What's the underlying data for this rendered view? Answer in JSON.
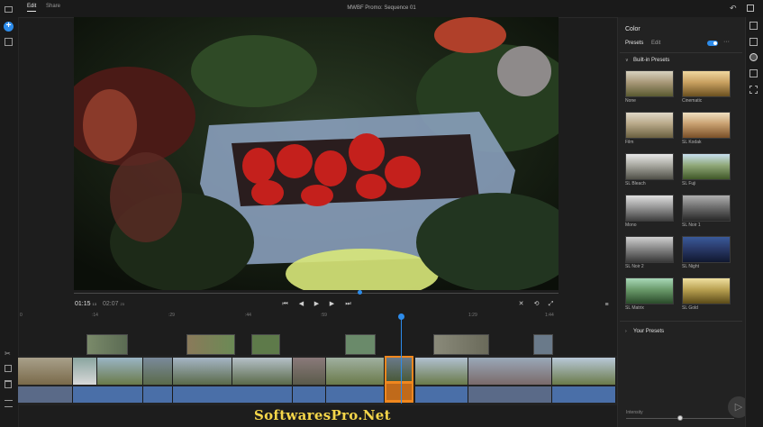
{
  "topbar": {
    "tabs": [
      {
        "label": "Edit",
        "active": true
      },
      {
        "label": "Share",
        "active": false
      }
    ],
    "title": "MWBF Promo: Sequence 01"
  },
  "viewer": {
    "timecode_current": "01:15",
    "timecode_current_frames": "13",
    "timecode_total": "02:07",
    "timecode_total_frames": "23"
  },
  "timeline": {
    "ruler_labels": [
      "0",
      ":14",
      ":29",
      ":44",
      ":59",
      "1:14",
      "1:29",
      "1:44"
    ]
  },
  "color_panel": {
    "title": "Color",
    "tabs": [
      "Presets",
      "Edit"
    ],
    "section_builtin": "Built-in Presets",
    "presets": [
      "None",
      "Cinematic",
      "Film",
      "SL Kodak",
      "SL Bleach",
      "SL Fuji",
      "Mono",
      "SL Noir 1",
      "SL Noir 2",
      "SL Night",
      "SL Matrix",
      "SL Gold"
    ],
    "section_yours": "Your Presets",
    "intensity_label": "Intensity",
    "intensity_value": 0.5
  },
  "watermark": "SoftwaresPro.Net",
  "colors": {
    "accent": "#2d8ceb",
    "selected_clip": "#f0871e",
    "audio_track": "#4a6fa8",
    "watermark": "#f5d64a"
  }
}
